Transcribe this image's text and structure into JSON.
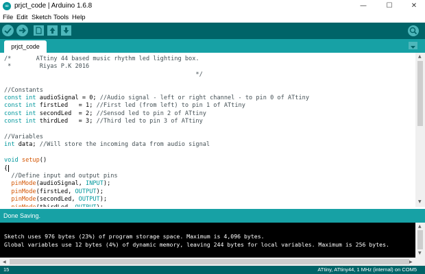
{
  "window": {
    "title": "prjct_code | Arduino 1.6.8",
    "minimize_glyph": "—",
    "maximize_glyph": "☐",
    "close_glyph": "✕",
    "app_icon_glyph": "∞"
  },
  "menu": {
    "items": [
      "File",
      "Edit",
      "Sketch",
      "Tools",
      "Help"
    ]
  },
  "toolbar": {
    "buttons": [
      "verify-icon",
      "upload-icon",
      "new-icon",
      "open-icon",
      "save-icon"
    ],
    "serial_monitor_icon": "magnifier-icon"
  },
  "tabs": [
    {
      "label": "prjct_code"
    }
  ],
  "tab_menu_icon": "triangle-down-icon",
  "code": {
    "lines": [
      [
        {
          "t": "/*       ATtiny 44 based music rhythm led lighting box.",
          "c": "cm"
        }
      ],
      [
        {
          "t": " *        Riyas P.K 2016",
          "c": "cm"
        }
      ],
      [
        {
          "t": "                                                      */",
          "c": "cm"
        }
      ],
      [],
      [
        {
          "t": "//Constants",
          "c": "cm"
        }
      ],
      [
        {
          "t": "const",
          "c": "kw"
        },
        {
          "t": " "
        },
        {
          "t": "int",
          "c": "kw"
        },
        {
          "t": " audioSignal = 0; "
        },
        {
          "t": "//Audio signal - left or right channel - to pin 0 of ATtiny",
          "c": "cm"
        }
      ],
      [
        {
          "t": "const",
          "c": "kw"
        },
        {
          "t": " "
        },
        {
          "t": "int",
          "c": "kw"
        },
        {
          "t": " firstLed   = 1; "
        },
        {
          "t": "//First led (from left) to pin 1 of ATtiny",
          "c": "cm"
        }
      ],
      [
        {
          "t": "const",
          "c": "kw"
        },
        {
          "t": " "
        },
        {
          "t": "int",
          "c": "kw"
        },
        {
          "t": " secondLed  = 2; "
        },
        {
          "t": "//Sensod led to pin 2 of ATtiny",
          "c": "cm"
        }
      ],
      [
        {
          "t": "const",
          "c": "kw"
        },
        {
          "t": " "
        },
        {
          "t": "int",
          "c": "kw"
        },
        {
          "t": " thirdLed   = 3; "
        },
        {
          "t": "//Third led to pin 3 of ATtiny",
          "c": "cm"
        }
      ],
      [],
      [
        {
          "t": "//Variables",
          "c": "cm"
        }
      ],
      [
        {
          "t": "int",
          "c": "kw"
        },
        {
          "t": " data; "
        },
        {
          "t": "//Will store the incoming data from audio signal",
          "c": "cm"
        }
      ],
      [],
      [
        {
          "t": "void",
          "c": "kw"
        },
        {
          "t": " "
        },
        {
          "t": "setup",
          "c": "fn"
        },
        {
          "t": "()"
        }
      ],
      [
        {
          "t": "{"
        }
      ],
      [
        {
          "t": "  "
        },
        {
          "t": "//Define input and output pins",
          "c": "cm"
        }
      ],
      [
        {
          "t": "  "
        },
        {
          "t": "pinMode",
          "c": "fn"
        },
        {
          "t": "(audioSignal, "
        },
        {
          "t": "INPUT",
          "c": "kw"
        },
        {
          "t": ");"
        }
      ],
      [
        {
          "t": "  "
        },
        {
          "t": "pinMode",
          "c": "fn"
        },
        {
          "t": "(firstLed, "
        },
        {
          "t": "OUTPUT",
          "c": "kw"
        },
        {
          "t": ");"
        }
      ],
      [
        {
          "t": "  "
        },
        {
          "t": "pinMode",
          "c": "fn"
        },
        {
          "t": "(secondLed, "
        },
        {
          "t": "OUTPUT",
          "c": "kw"
        },
        {
          "t": ");"
        }
      ],
      [
        {
          "t": "  "
        },
        {
          "t": "pinMode",
          "c": "fn"
        },
        {
          "t": "(thirdLed, "
        },
        {
          "t": "OUTPUT",
          "c": "kw"
        },
        {
          "t": ");"
        }
      ]
    ]
  },
  "status": {
    "message": "Done Saving."
  },
  "console": {
    "lines": [
      "Sketch uses 976 bytes (23%) of program storage space. Maximum is 4,096 bytes.",
      "Global variables use 12 bytes (4%) of dynamic memory, leaving 244 bytes for local variables. Maximum is 256 bytes."
    ]
  },
  "footer": {
    "line_number": "15",
    "board_info": "ATtiny, ATtiny44, 1 MHz (internal) on COM5"
  },
  "colors": {
    "toolbar_bg": "#006468",
    "tab_bar_bg": "#17a1a5",
    "button_bg": "#4db7bb",
    "keyword": "#00979c",
    "function": "#d35400",
    "comment": "#434f54"
  }
}
